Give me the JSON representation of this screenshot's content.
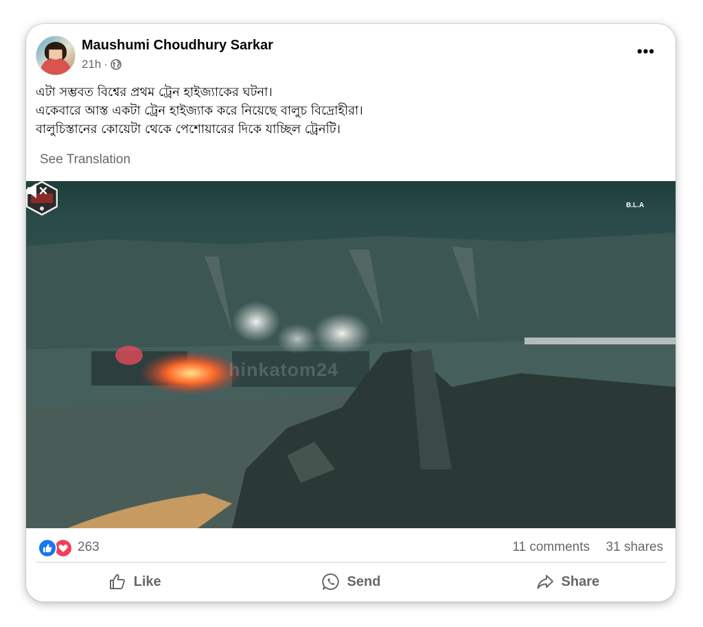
{
  "post": {
    "author": "Maushumi Choudhury Sarkar",
    "time": "21h",
    "separator": "·",
    "privacy_icon": "globe-icon",
    "more_icon": "more-options-icon",
    "text_lines": [
      "এটা সম্ভবত বিশ্বের প্রথম ট্রেন হাইজ্যাকের ঘটনা।",
      "একেবারে আস্ত একটা ট্রেন হাইজ্যাক করে নিয়েছে বালুচ বিদ্রোহীরা।",
      "বালুচিস্তানের কোয়েটা থেকে পেশোয়ারের দিকে যাচ্ছিল ট্রেনটি।"
    ],
    "see_translation": "See Translation"
  },
  "video": {
    "watermark": "hinkatom24",
    "logo_text": "B.L.A",
    "mute_icon": "muted-speaker-icon"
  },
  "engagement": {
    "reaction_count": "263",
    "comments": "11 comments",
    "shares": "31 shares"
  },
  "actions": {
    "like": "Like",
    "send": "Send",
    "share": "Share"
  },
  "colors": {
    "like_blue": "#1877f2",
    "love_red": "#f33e58",
    "secondary_text": "#65676b",
    "fire": "#ff5a2a"
  }
}
